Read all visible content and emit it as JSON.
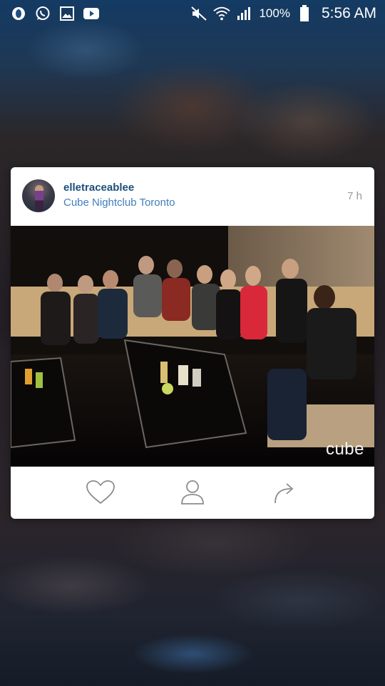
{
  "status_bar": {
    "battery": "100%",
    "time": "5:56 AM",
    "left_icons": [
      "opera-icon",
      "whatsapp-icon",
      "gallery-icon",
      "youtube-icon"
    ],
    "right_icons": [
      "mute-icon",
      "wifi-icon",
      "signal-icon",
      "battery-icon"
    ]
  },
  "post": {
    "username": "elletraceablee",
    "location": "Cube Nightclub Toronto",
    "time_ago": "7 h",
    "watermark": "cube"
  },
  "actions": {
    "like_icon": "heart-icon",
    "profile_icon": "person-icon",
    "share_icon": "share-arrow-icon"
  },
  "colors": {
    "username": "#1c4f7c",
    "location": "#3f7fbd",
    "time": "#9a9a9a",
    "icon": "#8c8c8c"
  }
}
